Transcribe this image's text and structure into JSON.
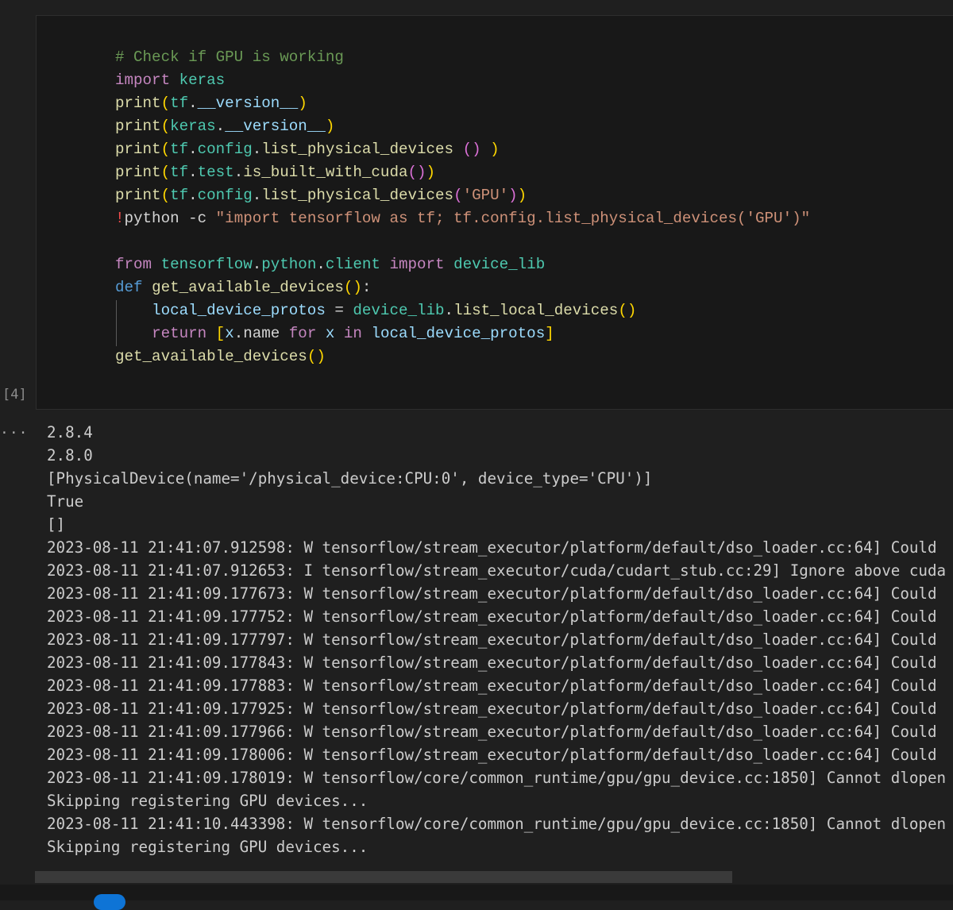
{
  "cell": {
    "execution_count": "[4]",
    "code_lines": [
      [
        {
          "t": "# Check if GPU is working",
          "c": "comment"
        }
      ],
      [
        {
          "t": "import",
          "c": "kw"
        },
        {
          "t": " ",
          "c": "plain"
        },
        {
          "t": "keras",
          "c": "mod"
        }
      ],
      [
        {
          "t": "print",
          "c": "fn"
        },
        {
          "t": "(",
          "c": "p1"
        },
        {
          "t": "tf",
          "c": "mod"
        },
        {
          "t": ".",
          "c": "plain"
        },
        {
          "t": "__version__",
          "c": "var"
        },
        {
          "t": ")",
          "c": "p1"
        }
      ],
      [
        {
          "t": "print",
          "c": "fn"
        },
        {
          "t": "(",
          "c": "p1"
        },
        {
          "t": "keras",
          "c": "mod"
        },
        {
          "t": ".",
          "c": "plain"
        },
        {
          "t": "__version__",
          "c": "var"
        },
        {
          "t": ")",
          "c": "p1"
        }
      ],
      [
        {
          "t": "print",
          "c": "fn"
        },
        {
          "t": "(",
          "c": "p1"
        },
        {
          "t": "tf",
          "c": "mod"
        },
        {
          "t": ".",
          "c": "plain"
        },
        {
          "t": "config",
          "c": "mod"
        },
        {
          "t": ".",
          "c": "plain"
        },
        {
          "t": "list_physical_devices",
          "c": "fn"
        },
        {
          "t": " ",
          "c": "plain"
        },
        {
          "t": "()",
          "c": "p2"
        },
        {
          "t": " ",
          "c": "plain"
        },
        {
          "t": ")",
          "c": "p1"
        }
      ],
      [
        {
          "t": "print",
          "c": "fn"
        },
        {
          "t": "(",
          "c": "p1"
        },
        {
          "t": "tf",
          "c": "mod"
        },
        {
          "t": ".",
          "c": "plain"
        },
        {
          "t": "test",
          "c": "mod"
        },
        {
          "t": ".",
          "c": "plain"
        },
        {
          "t": "is_built_with_cuda",
          "c": "fn"
        },
        {
          "t": "()",
          "c": "p2"
        },
        {
          "t": ")",
          "c": "p1"
        }
      ],
      [
        {
          "t": "print",
          "c": "fn"
        },
        {
          "t": "(",
          "c": "p1"
        },
        {
          "t": "tf",
          "c": "mod"
        },
        {
          "t": ".",
          "c": "plain"
        },
        {
          "t": "config",
          "c": "mod"
        },
        {
          "t": ".",
          "c": "plain"
        },
        {
          "t": "list_physical_devices",
          "c": "fn"
        },
        {
          "t": "(",
          "c": "p2"
        },
        {
          "t": "'GPU'",
          "c": "str"
        },
        {
          "t": ")",
          "c": "p2"
        },
        {
          "t": ")",
          "c": "p1"
        }
      ],
      [
        {
          "t": "!",
          "c": "bang"
        },
        {
          "t": "python -c ",
          "c": "plain"
        },
        {
          "t": "\"import tensorflow as tf; tf.config.list_physical_devices('GPU')\"",
          "c": "str"
        }
      ],
      [],
      [
        {
          "t": "from",
          "c": "kw"
        },
        {
          "t": " ",
          "c": "plain"
        },
        {
          "t": "tensorflow",
          "c": "mod"
        },
        {
          "t": ".",
          "c": "plain"
        },
        {
          "t": "python",
          "c": "mod"
        },
        {
          "t": ".",
          "c": "plain"
        },
        {
          "t": "client",
          "c": "mod"
        },
        {
          "t": " ",
          "c": "plain"
        },
        {
          "t": "import",
          "c": "kw"
        },
        {
          "t": " ",
          "c": "plain"
        },
        {
          "t": "device_lib",
          "c": "mod"
        }
      ],
      [
        {
          "t": "def",
          "c": "def"
        },
        {
          "t": " ",
          "c": "plain"
        },
        {
          "t": "get_available_devices",
          "c": "fn"
        },
        {
          "t": "()",
          "c": "p1"
        },
        {
          "t": ":",
          "c": "plain"
        }
      ],
      [
        {
          "t": "    ",
          "c": "plain"
        },
        {
          "t": "local_device_protos",
          "c": "var"
        },
        {
          "t": " = ",
          "c": "plain"
        },
        {
          "t": "device_lib",
          "c": "mod"
        },
        {
          "t": ".",
          "c": "plain"
        },
        {
          "t": "list_local_devices",
          "c": "fn"
        },
        {
          "t": "()",
          "c": "p1"
        }
      ],
      [
        {
          "t": "    ",
          "c": "plain"
        },
        {
          "t": "return",
          "c": "kw"
        },
        {
          "t": " ",
          "c": "plain"
        },
        {
          "t": "[",
          "c": "p1"
        },
        {
          "t": "x",
          "c": "var"
        },
        {
          "t": ".name ",
          "c": "plain"
        },
        {
          "t": "for",
          "c": "kw"
        },
        {
          "t": " ",
          "c": "plain"
        },
        {
          "t": "x",
          "c": "var"
        },
        {
          "t": " ",
          "c": "plain"
        },
        {
          "t": "in",
          "c": "kw"
        },
        {
          "t": " ",
          "c": "plain"
        },
        {
          "t": "local_device_protos",
          "c": "var"
        },
        {
          "t": "]",
          "c": "p1"
        }
      ],
      [
        {
          "t": "get_available_devices",
          "c": "fn"
        },
        {
          "t": "()",
          "c": "p1"
        }
      ]
    ]
  },
  "output": {
    "dots": "...",
    "lines": [
      "2.8.4",
      "2.8.0",
      "[PhysicalDevice(name='/physical_device:CPU:0', device_type='CPU')]",
      "True",
      "[]",
      "2023-08-11 21:41:07.912598: W tensorflow/stream_executor/platform/default/dso_loader.cc:64] Could",
      "2023-08-11 21:41:07.912653: I tensorflow/stream_executor/cuda/cudart_stub.cc:29] Ignore above cuda",
      "2023-08-11 21:41:09.177673: W tensorflow/stream_executor/platform/default/dso_loader.cc:64] Could",
      "2023-08-11 21:41:09.177752: W tensorflow/stream_executor/platform/default/dso_loader.cc:64] Could",
      "2023-08-11 21:41:09.177797: W tensorflow/stream_executor/platform/default/dso_loader.cc:64] Could",
      "2023-08-11 21:41:09.177843: W tensorflow/stream_executor/platform/default/dso_loader.cc:64] Could",
      "2023-08-11 21:41:09.177883: W tensorflow/stream_executor/platform/default/dso_loader.cc:64] Could",
      "2023-08-11 21:41:09.177925: W tensorflow/stream_executor/platform/default/dso_loader.cc:64] Could",
      "2023-08-11 21:41:09.177966: W tensorflow/stream_executor/platform/default/dso_loader.cc:64] Could",
      "2023-08-11 21:41:09.178006: W tensorflow/stream_executor/platform/default/dso_loader.cc:64] Could",
      "2023-08-11 21:41:09.178019: W tensorflow/core/common_runtime/gpu/gpu_device.cc:1850] Cannot dlopen",
      "Skipping registering GPU devices...",
      "2023-08-11 21:41:10.443398: W tensorflow/core/common_runtime/gpu/gpu_device.cc:1850] Cannot dlopen",
      "Skipping registering GPU devices..."
    ]
  },
  "colors": {
    "background": "#1f1f1f",
    "cell_background": "#181818",
    "accent_blue": "#0e74d6"
  }
}
